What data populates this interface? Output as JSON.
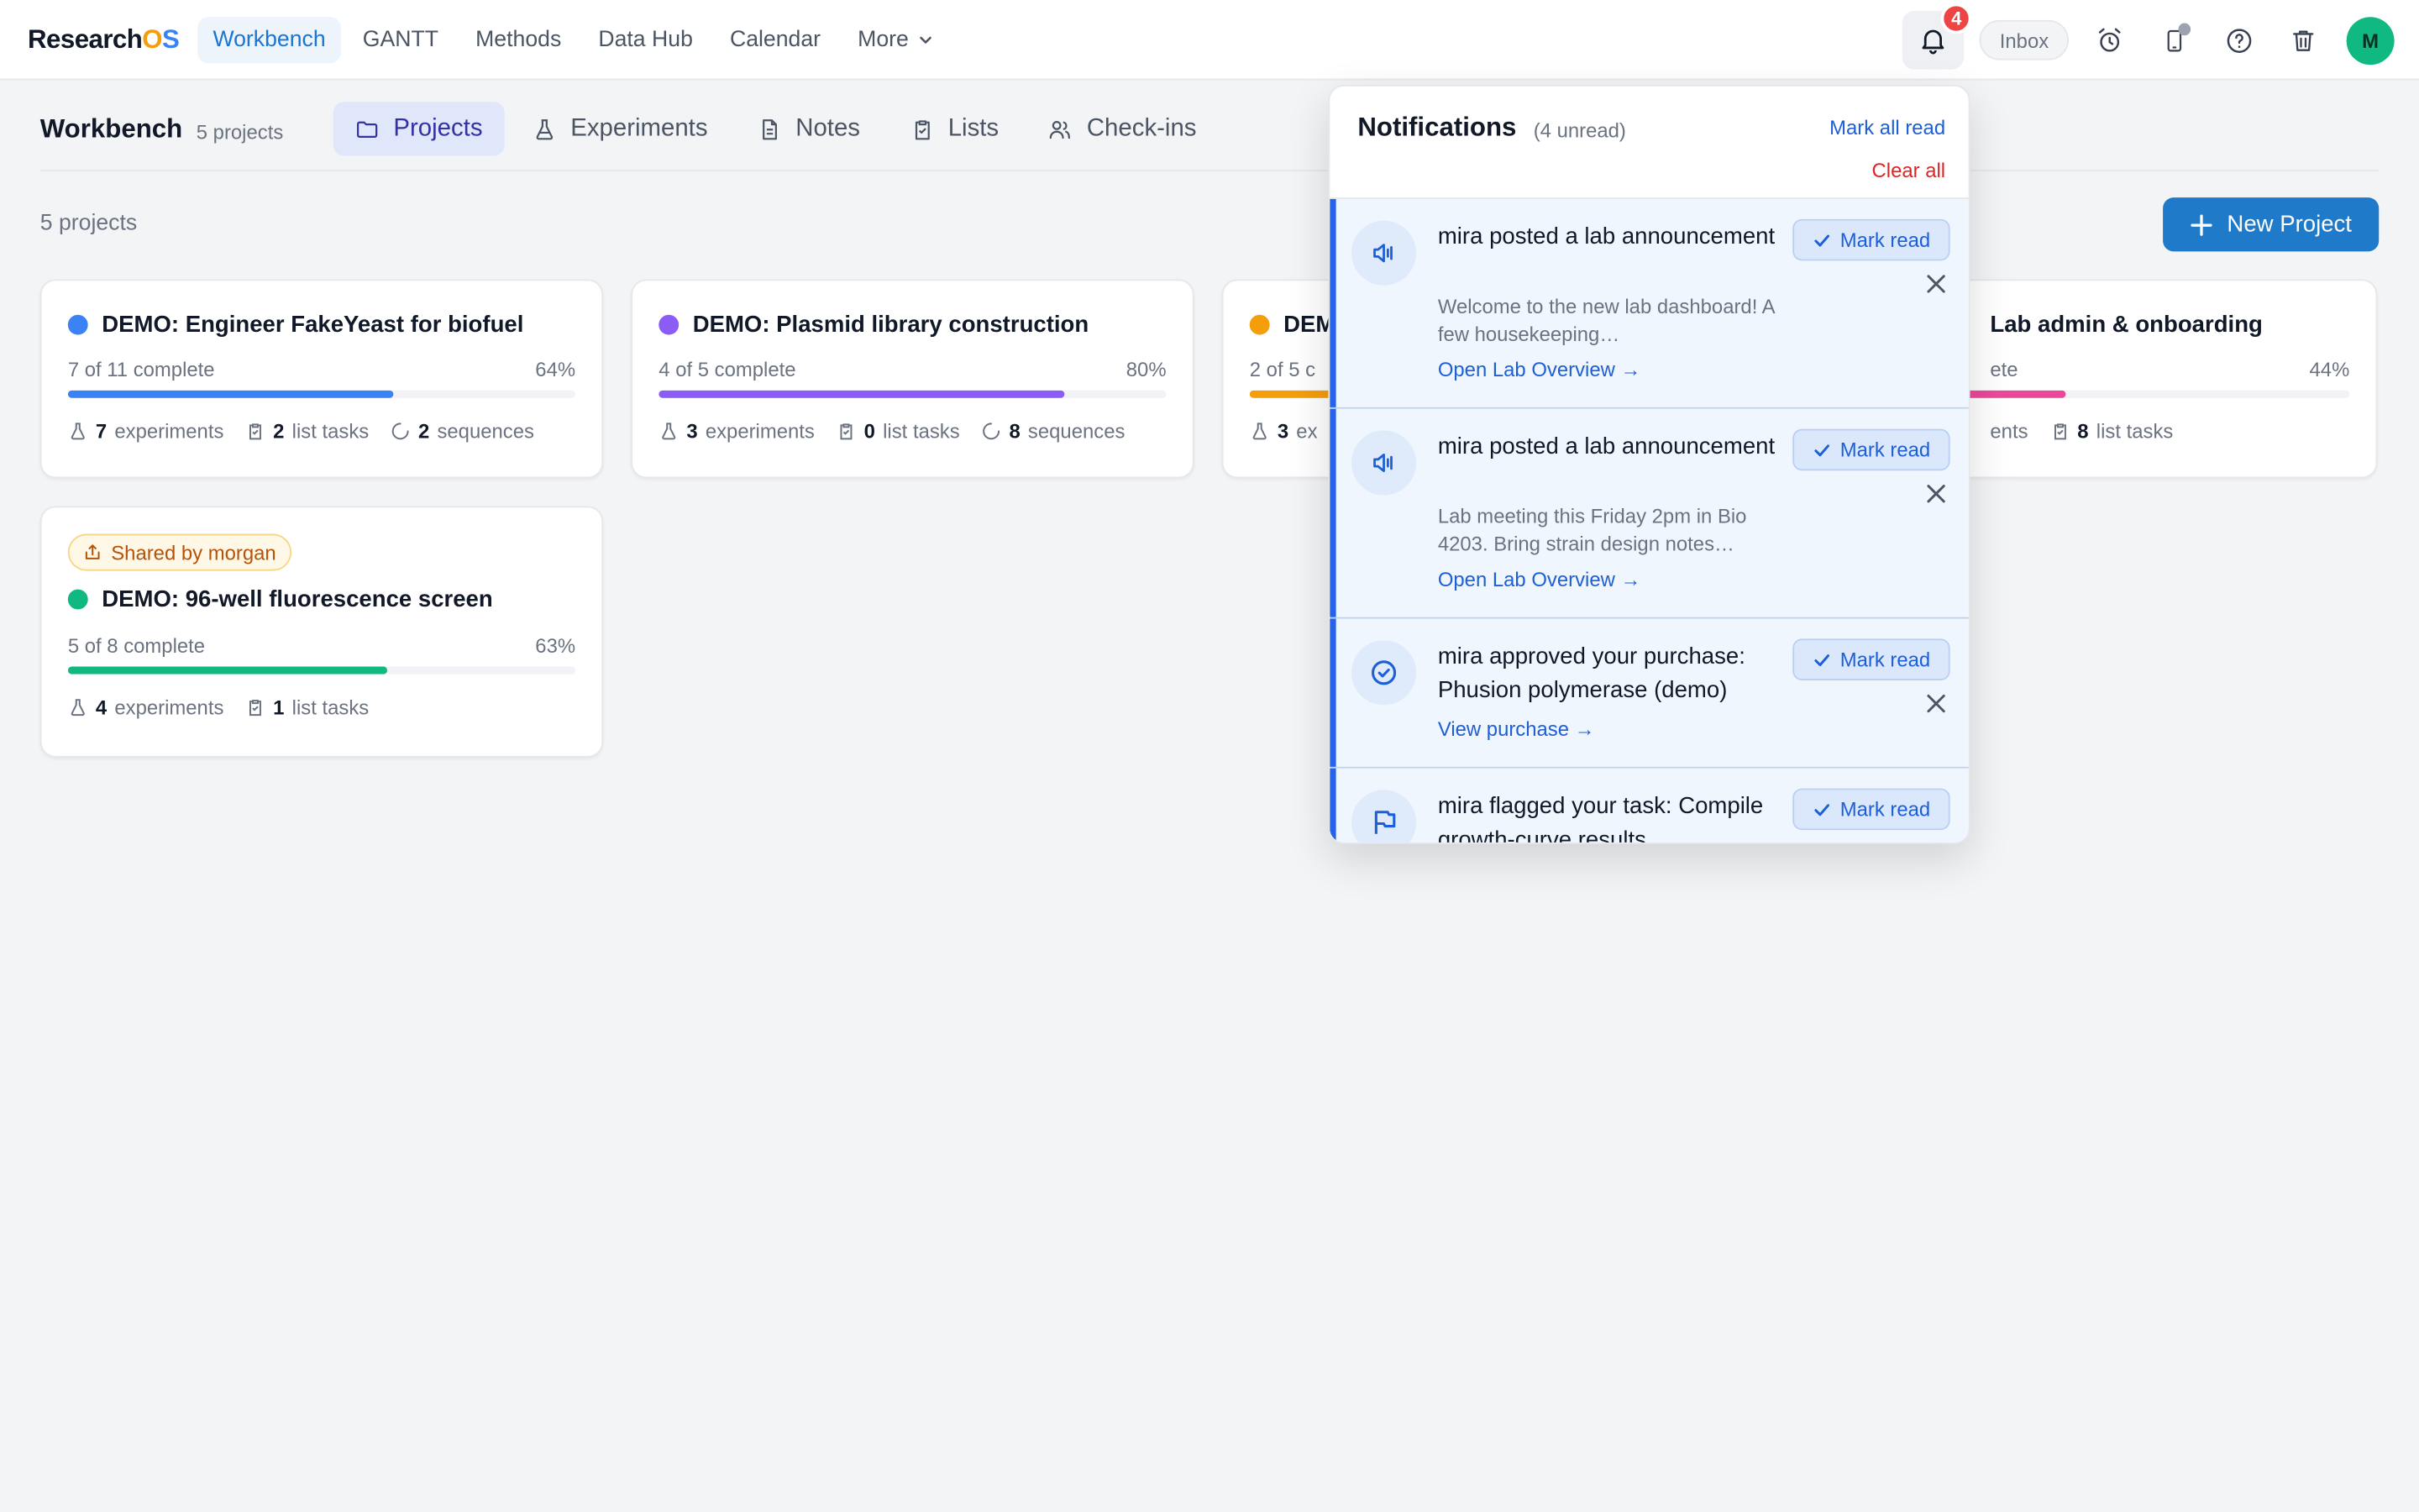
{
  "app": {
    "logo_main": "Research",
    "logo_o": "O",
    "logo_s": "S"
  },
  "nav": {
    "items": [
      {
        "label": "Workbench",
        "active": true
      },
      {
        "label": "GANTT"
      },
      {
        "label": "Methods"
      },
      {
        "label": "Data Hub"
      },
      {
        "label": "Calendar"
      },
      {
        "label": "More"
      }
    ]
  },
  "topbar": {
    "notification_count": "4",
    "inbox_label": "Inbox",
    "avatar_initial": "M"
  },
  "workbench": {
    "title": "Workbench",
    "subtitle": "5 projects",
    "tabs": [
      "Projects",
      "Experiments",
      "Notes",
      "Lists",
      "Check-ins"
    ],
    "projects_count": "5 projects",
    "new_project_label": "New Project"
  },
  "projects": [
    {
      "title": "DEMO: Engineer FakeYeast for biofuel",
      "color": "#3b82f6",
      "progress_text": "7 of 11 complete",
      "percent_label": "64%",
      "percent": 64,
      "experiments_n": "7",
      "experiments_label": "experiments",
      "tasks_n": "2",
      "tasks_label": "list tasks",
      "sequences_n": "2",
      "sequences_label": "sequences"
    },
    {
      "title": "DEMO: Plasmid library construction",
      "color": "#8b5cf6",
      "progress_text": "4 of 5 complete",
      "percent_label": "80%",
      "percent": 80,
      "experiments_n": "3",
      "experiments_label": "experiments",
      "tasks_n": "0",
      "tasks_label": "list tasks",
      "sequences_n": "8",
      "sequences_label": "sequences"
    },
    {
      "title_visible": "DEM",
      "color": "#f59e0b",
      "progress_text_visible": "2 of 5 c",
      "experiments_n": "3",
      "experiments_label_visible": "ex"
    },
    {
      "title_visible": "Lab admin & onboarding",
      "color": "#ec4899",
      "progress_text_visible": "ete",
      "percent_label": "44%",
      "percent": 44,
      "experiments_label_visible": "ents",
      "tasks_n": "8",
      "tasks_label": "list tasks"
    },
    {
      "shared_label": "Shared by morgan",
      "title": "DEMO: 96-well fluorescence screen",
      "color": "#10b981",
      "progress_text": "5 of 8 complete",
      "percent_label": "63%",
      "percent": 63,
      "experiments_n": "4",
      "experiments_label": "experiments",
      "tasks_n": "1",
      "tasks_label": "list tasks"
    }
  ],
  "notifications": {
    "title": "Notifications",
    "unread_label": "(4 unread)",
    "mark_all_read": "Mark all read",
    "clear_all": "Clear all",
    "mark_read_label": "Mark read",
    "items": [
      {
        "icon": "megaphone-icon",
        "actor": "mira",
        "text": " posted a lab announcement",
        "desc": "Welcome to the new lab dashboard! A few housekeeping…",
        "link": "Open Lab Overview →"
      },
      {
        "icon": "megaphone-icon",
        "actor": "mira",
        "text": " posted a lab announcement",
        "desc": "Lab meeting this Friday 2pm in Bio 4203. Bring strain design notes…",
        "link": "Open Lab Overview →"
      },
      {
        "icon": "check-circle-icon",
        "actor": "mira",
        "text": " approved your purchase: Phusion polymerase (demo)",
        "link": "View purchase →"
      },
      {
        "icon": "flag-icon",
        "actor": "mira",
        "text": " flagged your task: Compile growth-curve results"
      }
    ]
  }
}
